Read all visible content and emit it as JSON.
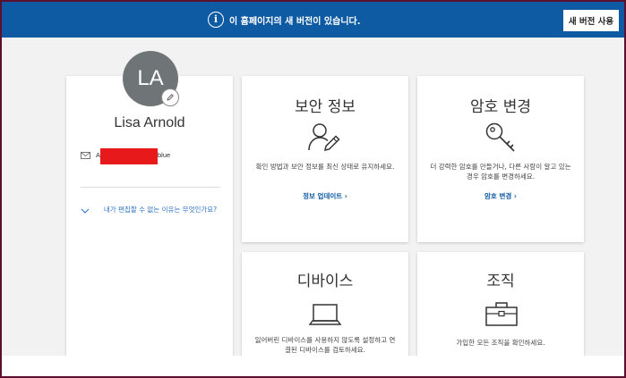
{
  "banner": {
    "info_icon": "i",
    "text": "이 홈페이지의 새 버전이 있습니다.",
    "button_label": "새 버전 사용",
    "background": "#0f5ba3"
  },
  "profile": {
    "initials": "LA",
    "name": "Lisa Arnold",
    "email_prefix": "A",
    "email_suffix": "blue",
    "why_link": "내가 편집할 수 없는 이유는 무엇인가요?"
  },
  "cards": {
    "security": {
      "title": "보안 정보",
      "icon": "person-edit-icon",
      "description": "확인 방법과 보안 정보를 최신 상태로 유지하세요.",
      "link": "정보 업데이트 ›"
    },
    "password": {
      "title": "암호 변경",
      "icon": "key-icon",
      "description": "더 강력한 암호를 만들거나, 다른 사람이 알고 있는 경우 암호를 변경하세요.",
      "link": "암호 변경 ›"
    },
    "devices": {
      "title": "디바이스",
      "icon": "laptop-icon",
      "description": "잃어버린 디바이스를 사용하지 않도록 설정하고 연결된 디바이스를 검토하세요."
    },
    "organizations": {
      "title": "조직",
      "icon": "briefcase-icon",
      "description": "가입한 모든 조직을 확인하세요."
    }
  },
  "colors": {
    "link": "#0f5ba3",
    "avatar": "#6f7577",
    "redaction": "#e8191b"
  }
}
